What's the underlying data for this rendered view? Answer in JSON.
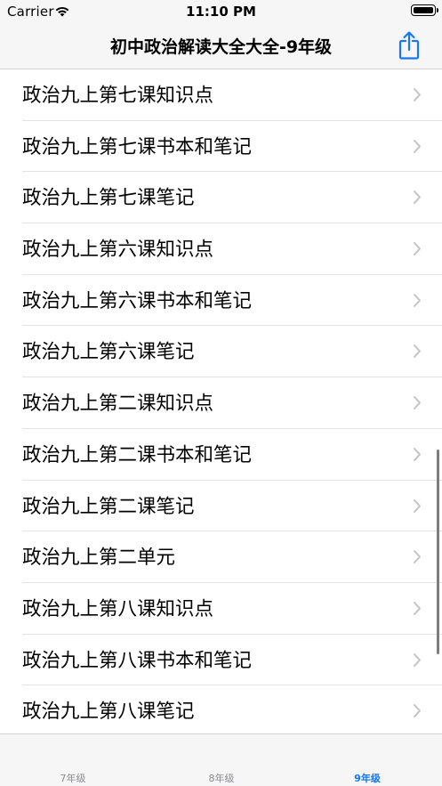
{
  "status_bar": {
    "carrier": "Carrier",
    "time": "11:10 PM",
    "wifi_icon": "wifi-icon",
    "battery_icon": "battery-icon"
  },
  "nav": {
    "title": "初中政治解读大全大全-9年级",
    "share_icon": "share-icon"
  },
  "list": {
    "items": [
      {
        "label": "政治九上第七课知识点"
      },
      {
        "label": "政治九上第七课书本和笔记"
      },
      {
        "label": "政治九上第七课笔记"
      },
      {
        "label": "政治九上第六课知识点"
      },
      {
        "label": "政治九上第六课书本和笔记"
      },
      {
        "label": "政治九上第六课笔记"
      },
      {
        "label": "政治九上第二课知识点"
      },
      {
        "label": "政治九上第二课书本和笔记"
      },
      {
        "label": "政治九上第二课笔记"
      },
      {
        "label": "政治九上第二单元"
      },
      {
        "label": "政治九上第八课知识点"
      },
      {
        "label": "政治九上第八课书本和笔记"
      },
      {
        "label": "政治九上第八课笔记"
      }
    ]
  },
  "tabs": [
    {
      "label": "7年级",
      "active": false
    },
    {
      "label": "8年级",
      "active": false
    },
    {
      "label": "9年级",
      "active": true
    }
  ],
  "colors": {
    "accent": "#1877f2",
    "inactive_tab": "#8a8a8e",
    "bar_background": "#f6f6f7"
  }
}
